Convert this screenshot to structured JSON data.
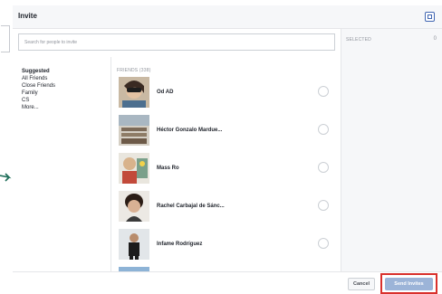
{
  "dialog": {
    "title": "Invite"
  },
  "search": {
    "placeholder": "Search for people to invite"
  },
  "lists": {
    "items": [
      {
        "label": "Suggested",
        "active": true
      },
      {
        "label": "All Friends",
        "active": false
      },
      {
        "label": "Close Friends",
        "active": false
      },
      {
        "label": "Family",
        "active": false
      },
      {
        "label": "CS",
        "active": false
      },
      {
        "label": "More...",
        "active": false
      }
    ]
  },
  "friends": {
    "heading": "FRIENDS (338)",
    "items": [
      {
        "name": "Od AD"
      },
      {
        "name": "Héctor Gonzalo Mardue..."
      },
      {
        "name": "Mass Ro"
      },
      {
        "name": "Rachel Carbajal de Sánc..."
      },
      {
        "name": "Infame Rodríguez"
      }
    ]
  },
  "selected": {
    "label": "SELECTED",
    "count": "0"
  },
  "footer": {
    "cancel_label": "Cancel",
    "send_label": "Send Invites"
  },
  "colors": {
    "accent": "#4267b2",
    "send_button": "#9cb4d8",
    "highlight": "#d9302c"
  }
}
